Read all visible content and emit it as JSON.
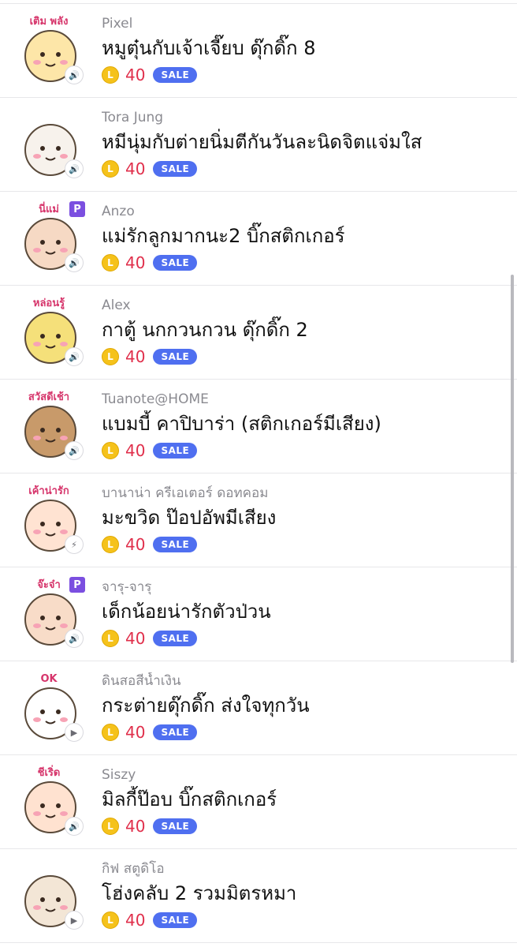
{
  "items": [
    {
      "author": "Pixel",
      "title": "หมูตุ๋นกับเจ้าเจี๊ยบ ดุ๊กดิ๊ก 8",
      "price": "40",
      "coin": "L",
      "sale": "SALE",
      "play_icon": "sound-icon",
      "premium": false,
      "thumb_text": "เติม  พลัง"
    },
    {
      "author": "Tora Jung",
      "title": "หมีนุ่มกับต่ายนิ่มตีกันวันละนิดจิตแจ่มใส",
      "price": "40",
      "coin": "L",
      "sale": "SALE",
      "play_icon": "sound-icon",
      "premium": false,
      "thumb_text": ""
    },
    {
      "author": "Anzo",
      "title": "แม่รักลูกมากนะ2 บิ๊กสติกเกอร์",
      "price": "40",
      "coin": "L",
      "sale": "SALE",
      "play_icon": "sound-icon",
      "premium": true,
      "premium_label": "P",
      "thumb_text": "นี่แม่"
    },
    {
      "author": "Alex",
      "title": "กาตู้ นกกวนกวน ดุ๊กดิ๊ก 2",
      "price": "40",
      "coin": "L",
      "sale": "SALE",
      "play_icon": "sound-icon",
      "premium": false,
      "thumb_text": "หล่อนรู้"
    },
    {
      "author": "Tuanote@HOME",
      "title": "แบมบี้ คาปิบาร่า (สติกเกอร์มีเสียง)",
      "price": "40",
      "coin": "L",
      "sale": "SALE",
      "play_icon": "sound-icon",
      "premium": false,
      "thumb_text": "สวัสดีเช้า"
    },
    {
      "author": "บานาน่า ครีเอเตอร์ ดอทคอม",
      "title": "มะขวิด ป๊อปอัพมีเสียง",
      "price": "40",
      "coin": "L",
      "sale": "SALE",
      "play_icon": "popup-icon",
      "premium": false,
      "thumb_text": "เค้าน่ารัก"
    },
    {
      "author": "จารุ-จารุ",
      "title": "เด็กน้อยน่ารักตัวป่วน",
      "price": "40",
      "coin": "L",
      "sale": "SALE",
      "play_icon": "sound-icon",
      "premium": true,
      "premium_label": "P",
      "thumb_text": "จ๊ะจ๋า"
    },
    {
      "author": "ดินสอสีน้ำเงิน",
      "title": "กระต่ายดุ๊กดิ๊ก ส่งใจทุกวัน",
      "price": "40",
      "coin": "L",
      "sale": "SALE",
      "play_icon": "play-icon",
      "premium": false,
      "thumb_text": "OK"
    },
    {
      "author": "Siszy",
      "title": "มิลกี้ป๊อบ บิ๊กสติกเกอร์",
      "price": "40",
      "coin": "L",
      "sale": "SALE",
      "play_icon": "sound-icon",
      "premium": false,
      "thumb_text": "ชีเริ่ด"
    },
    {
      "author": "กิฟ สตูดิโอ",
      "title": "โฮ่งคลับ 2 รวมมิตรหมา",
      "price": "40",
      "coin": "L",
      "sale": "SALE",
      "play_icon": "play-icon",
      "premium": false,
      "thumb_text": ""
    }
  ],
  "colors": {
    "price": "#e02f4b",
    "sale_badge": "#4f6ff0",
    "coin": "#f5c21b",
    "premium_badge": "#7b4fe0"
  }
}
